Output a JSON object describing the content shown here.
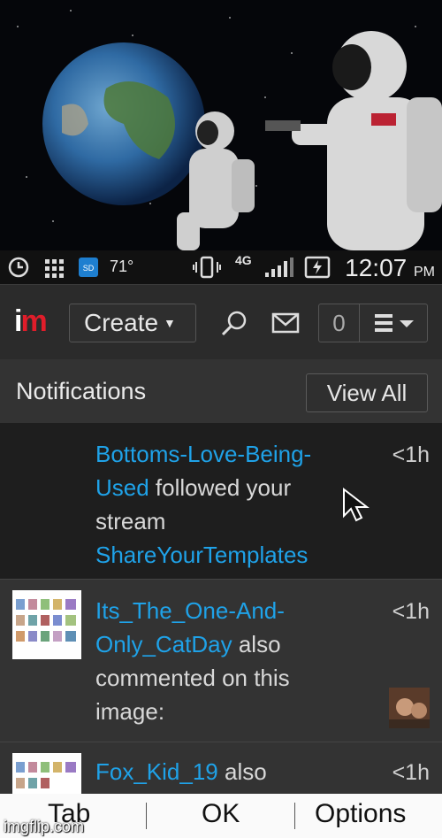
{
  "status_bar": {
    "temperature": "71°",
    "network": "4G",
    "time": "12:07",
    "ampm": "PM"
  },
  "header": {
    "logo_i": "i",
    "logo_m": "m",
    "create_label": "Create",
    "notification_count": "0"
  },
  "notifications": {
    "title": "Notifications",
    "view_all": "View All",
    "items": [
      {
        "user": "Bottoms-Love-Being-Used",
        "action": " followed your stream ",
        "target": "ShareYourTemplates",
        "time": "<1h"
      },
      {
        "user": "Its_The_One-And-Only_CatDay",
        "action": " also commented on this image:",
        "time": "<1h"
      },
      {
        "user": "Fox_Kid_19",
        "action": " also",
        "time": "<1h"
      }
    ]
  },
  "softkeys": {
    "left": "Tab",
    "center": "OK",
    "right": "Options"
  },
  "watermark": "imgflip.com",
  "colors": {
    "link": "#1fa2e8",
    "brand_red": "#e01d2a"
  },
  "icons": [
    "alarm-icon",
    "grid-icon",
    "sd-card-icon",
    "vibrate-icon",
    "signal-icon",
    "battery-charging-icon",
    "search-icon",
    "mail-icon",
    "menu-icon",
    "cursor-icon"
  ]
}
